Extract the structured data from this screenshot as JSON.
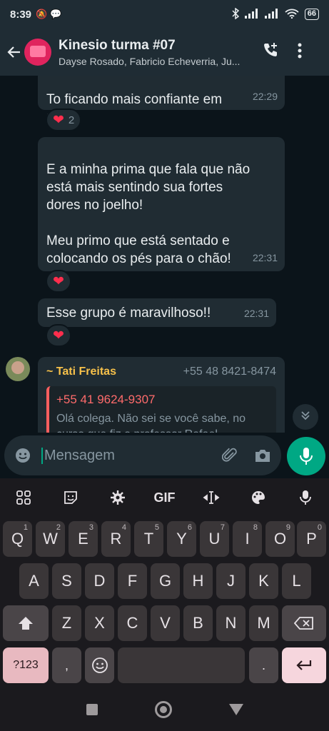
{
  "status_bar": {
    "time": "8:39",
    "battery": "66"
  },
  "header": {
    "title": "Kinesio turma #07",
    "subtitle": "Dayse Rosado, Fabricio Echeverria, Ju..."
  },
  "messages": [
    {
      "text": "To ficando mais confiante em\nmim!",
      "time": "22:29",
      "reaction": "❤️",
      "reaction_count": "2"
    },
    {
      "text": "E a minha prima que fala que não\nestá mais sentindo sua fortes\ndores no joelho!\n\nMeu primo que está sentado e\ncolocando os pés para o chão!",
      "time": "22:31",
      "reaction": "❤️"
    },
    {
      "text": "Esse grupo é maravilhoso!!",
      "time": "22:31",
      "reaction": "❤️"
    }
  ],
  "incoming": {
    "sender_name": "~ Tati Freitas",
    "sender_phone": "+55 48 8421-8474",
    "quote_phone": "+55 41 9624-9307",
    "quote_text": "Olá colega. Não sei se você sabe, no curso que fiz o professor Rafael"
  },
  "composer": {
    "placeholder": "Mensagem"
  },
  "keyboard": {
    "toolbar": [
      "grid-icon",
      "sticker-icon",
      "gear-icon",
      "GIF",
      "cursor-icon",
      "palette-icon",
      "mic-icon"
    ],
    "gif_label": "GIF",
    "row1": [
      {
        "k": "Q",
        "h": "1"
      },
      {
        "k": "W",
        "h": "2"
      },
      {
        "k": "E",
        "h": "3"
      },
      {
        "k": "R",
        "h": "4"
      },
      {
        "k": "T",
        "h": "5"
      },
      {
        "k": "Y",
        "h": "6"
      },
      {
        "k": "U",
        "h": "7"
      },
      {
        "k": "I",
        "h": "8"
      },
      {
        "k": "O",
        "h": "9"
      },
      {
        "k": "P",
        "h": "0"
      }
    ],
    "row2": [
      "A",
      "S",
      "D",
      "F",
      "G",
      "H",
      "J",
      "K",
      "L"
    ],
    "row3": [
      "Z",
      "X",
      "C",
      "V",
      "B",
      "N",
      "M"
    ],
    "sym_label": "?123",
    "comma": ",",
    "period": "."
  },
  "colors": {
    "accent": "#00a884",
    "heart": "#ff2e4d",
    "sender_name": "#f7c14a",
    "quote_phone": "#ff6b6b"
  }
}
